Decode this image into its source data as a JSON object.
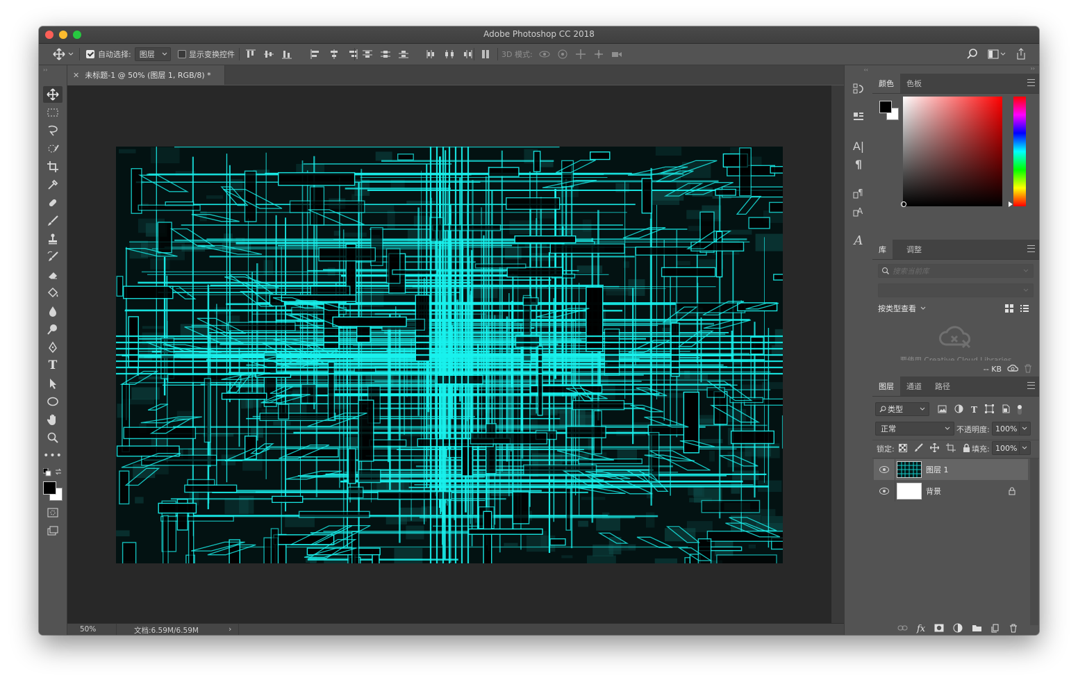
{
  "window": {
    "title": "Adobe Photoshop CC 2018"
  },
  "options_bar": {
    "auto_select_label": "自动选择:",
    "auto_select_target": "图层",
    "show_transform_label": "显示变换控件",
    "mode_3d_label": "3D 模式:"
  },
  "document": {
    "tab_title": "未标题-1 @ 50% (图层 1, RGB/8) *",
    "zoom": "50%",
    "doc_size": "文档:6.59M/6.59M"
  },
  "color_panel": {
    "tabs": [
      "颜色",
      "色板"
    ],
    "foreground": "#000000",
    "background": "#ffffff",
    "hue_color": "#ff0000"
  },
  "library_panel": {
    "tabs": [
      "库",
      "调整"
    ],
    "search_placeholder": "搜索当前库",
    "view_by": "按类型查看",
    "cc_message": "要使用 Creative Cloud Libraries",
    "size": "-- KB"
  },
  "layers_panel": {
    "tabs": [
      "图层",
      "通道",
      "路径"
    ],
    "filter_kind": "类型",
    "blend_mode": "正常",
    "opacity_label": "不透明度:",
    "opacity_value": "100%",
    "lock_label": "锁定:",
    "fill_label": "填充:",
    "fill_value": "100%",
    "layers": [
      {
        "name": "图层 1",
        "selected": true,
        "locked": false
      },
      {
        "name": "背景",
        "selected": false,
        "locked": true
      }
    ]
  },
  "colors": {
    "artwork_glow": "#19f2ee",
    "artwork_bg": "#031212",
    "accent_select": "#656565"
  }
}
